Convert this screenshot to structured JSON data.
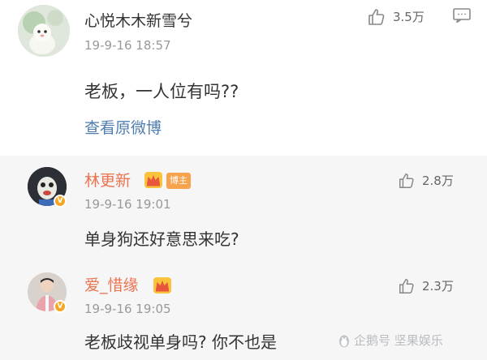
{
  "top_post": {
    "username": "心悦木木新雪兮",
    "time": "19-9-16 18:57",
    "likes": "3.5万",
    "content": "老板，一人位有吗??",
    "view_original": "查看原微博"
  },
  "replies": [
    {
      "username": "林更新",
      "tag": "博主",
      "time": "19-9-16 19:01",
      "likes": "2.8万",
      "content": "单身狗还好意思来吃?"
    },
    {
      "username": "爱_惜缘",
      "time": "19-9-16 19:05",
      "likes": "2.3万",
      "content": "老板歧视单身吗? 你不也是"
    }
  ],
  "watermark": "企鹅号 坚果娱乐",
  "icons": {
    "like": "thumbs-up-icon",
    "comment": "comment-icon",
    "crown": "crown-icon",
    "verified": "verified-v-icon",
    "watermark": "penguin-icon"
  },
  "colors": {
    "username_highlight": "#eb7350",
    "link": "#507daf",
    "verified_badge": "#f5a623",
    "tag_bg": "#f7a24c",
    "reply_bg": "#f6f6f6"
  }
}
